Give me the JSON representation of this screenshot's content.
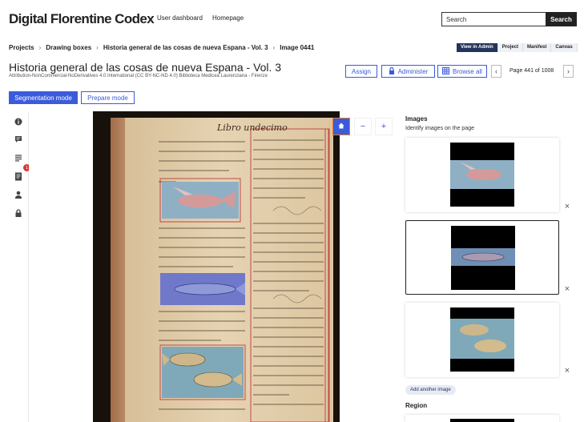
{
  "nav": {
    "brand": "Digital Florentine Codex",
    "links": [
      "User dashboard",
      "Homepage"
    ],
    "search_placeholder": "Search",
    "search_button": "Search"
  },
  "breadcrumb": [
    "Projects",
    "Drawing boxes",
    "Historia general de las cosas de nueva Espana - Vol. 3",
    "Image 0441"
  ],
  "view_tabs": [
    {
      "label": "View in Admin",
      "active": true
    },
    {
      "label": "Project",
      "active": false
    },
    {
      "label": "Manifest",
      "active": false
    },
    {
      "label": "Canvas",
      "active": false
    }
  ],
  "header": {
    "title": "Historia general de las cosas de nueva Espana - Vol. 3",
    "license": "Attribution-NonCommercial-NoDerivatives 4.0 International (CC BY-NC-ND 4.0) Biblioteca Medicea Laurenziana - Firenze",
    "assign": "Assign",
    "administer": "Administer",
    "browse_all": "Browse all",
    "page_indicator": "Page 441 of 1008"
  },
  "modes": {
    "segmentation": "Segmentation mode",
    "prepare": "Prepare mode"
  },
  "sidebar": {
    "icons": [
      "info-icon",
      "comment-icon",
      "list-icon",
      "document-icon",
      "user-icon",
      "lock-icon"
    ],
    "badge": "1"
  },
  "viewer": {
    "page_heading": "Libro undecimo",
    "zoom_in": "+",
    "zoom_out": "−"
  },
  "images_panel": {
    "title": "Images",
    "subtitle": "Identify images on the page",
    "add_label": "Add another image",
    "region_title": "Region"
  },
  "colors": {
    "accent": "#3b5bdb",
    "dark_navy": "#22345c",
    "badge_red": "#d93636"
  }
}
